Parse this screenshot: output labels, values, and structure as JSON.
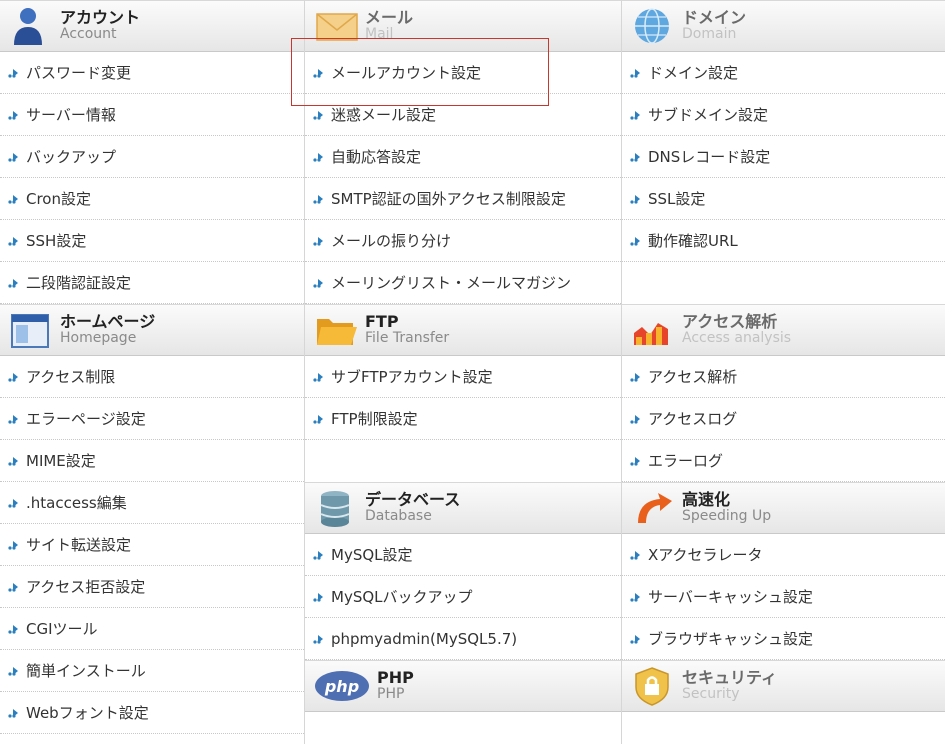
{
  "sections": {
    "account": {
      "title": "アカウント",
      "subtitle": "Account",
      "icon": "person-icon",
      "items": [
        "パスワード変更",
        "サーバー情報",
        "バックアップ",
        "Cron設定",
        "SSH設定",
        "二段階認証設定"
      ]
    },
    "mail": {
      "title": "メール",
      "subtitle": "Mail",
      "icon": "envelope-icon",
      "items": [
        "メールアカウント設定",
        "迷惑メール設定",
        "自動応答設定",
        "SMTP認証の国外アクセス制限設定",
        "メールの振り分け",
        "メーリングリスト・メールマガジン"
      ]
    },
    "domain": {
      "title": "ドメイン",
      "subtitle": "Domain",
      "icon": "globe-icon",
      "items": [
        "ドメイン設定",
        "サブドメイン設定",
        "DNSレコード設定",
        "SSL設定",
        "動作確認URL"
      ]
    },
    "homepage": {
      "title": "ホームページ",
      "subtitle": "Homepage",
      "icon": "browser-window-icon",
      "items": [
        "アクセス制限",
        "エラーページ設定",
        "MIME設定",
        ".htaccess編集",
        "サイト転送設定",
        "アクセス拒否設定",
        "CGIツール",
        "簡単インストール",
        "Webフォント設定"
      ]
    },
    "ftp": {
      "title": "FTP",
      "subtitle": "File Transfer",
      "icon": "folder-icon",
      "items": [
        "サブFTPアカウント設定",
        "FTP制限設定"
      ]
    },
    "analytics": {
      "title": "アクセス解析",
      "subtitle": "Access analysis",
      "icon": "bar-chart-icon",
      "items": [
        "アクセス解析",
        "アクセスログ",
        "エラーログ"
      ]
    },
    "database": {
      "title": "データベース",
      "subtitle": "Database",
      "icon": "database-icon",
      "items": [
        "MySQL設定",
        "MySQLバックアップ",
        "phpmyadmin(MySQL5.7)"
      ]
    },
    "speed": {
      "title": "高速化",
      "subtitle": "Speeding Up",
      "icon": "curved-arrow-icon",
      "items": [
        "Xアクセラレータ",
        "サーバーキャッシュ設定",
        "ブラウザキャッシュ設定"
      ]
    },
    "php": {
      "title": "PHP",
      "subtitle": "PHP",
      "icon": "php-logo-icon",
      "icon_text": "php",
      "items": []
    },
    "security": {
      "title": "セキュリティ",
      "subtitle": "Security",
      "icon": "padlock-shield-icon",
      "items": []
    }
  },
  "highlight": {
    "target": "メールアカウント設定",
    "color": "#c8372d"
  },
  "colors": {
    "arrow": "#2b7fbf",
    "header_bg": "#ececec",
    "divider": "#c8c8c8"
  }
}
